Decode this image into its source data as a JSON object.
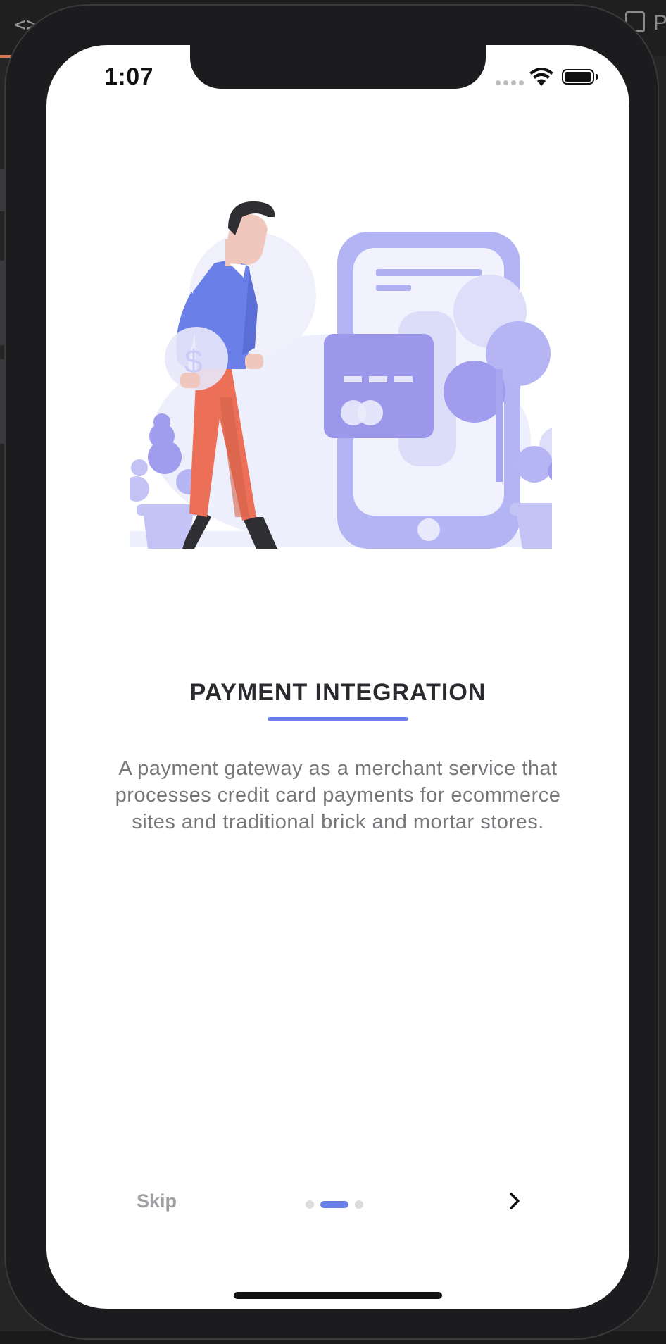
{
  "status_bar": {
    "time": "1:07",
    "icons": [
      "cellular-signal-icon",
      "wifi-icon",
      "battery-icon"
    ]
  },
  "onboarding": {
    "illustration": "payment-card-phone-illustration",
    "title": "PAYMENT INTEGRATION",
    "description": "A payment gateway as a merchant service that processes credit card payments for ecommerce sites and traditional brick and mortar stores.",
    "page_indicator": {
      "total": 3,
      "active": 2
    },
    "skip_label": "Skip",
    "next_icon": "chevron-right-icon"
  },
  "colors": {
    "accent": "#6b7fe8",
    "illustration_purple": "#a9a6f2",
    "illustration_light": "#ecedfb",
    "pants": "#ec7057",
    "title_text": "#2a2a2e",
    "body_text": "#77777b",
    "skip_text": "#a0a0a4"
  }
}
